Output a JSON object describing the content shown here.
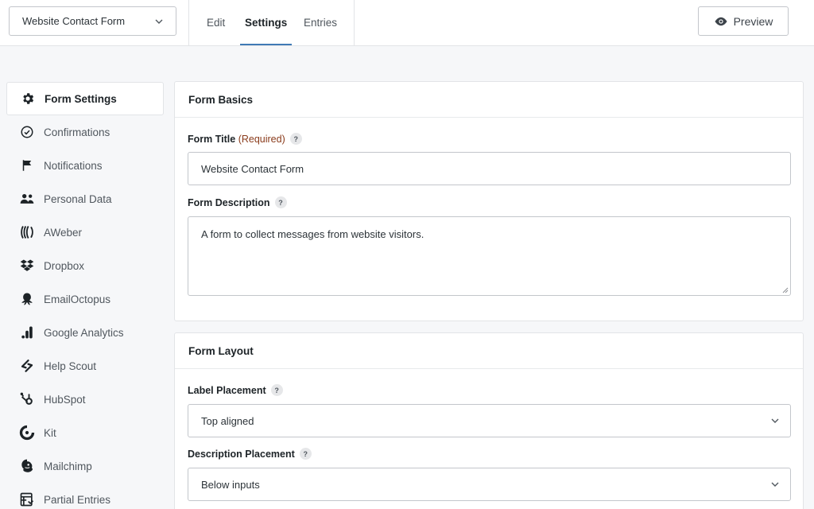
{
  "header": {
    "form_selector": "Website Contact Form",
    "tabs": [
      "Edit",
      "Settings",
      "Entries"
    ],
    "active_tab": "Settings",
    "preview_label": "Preview"
  },
  "sidebar": {
    "items": [
      {
        "label": "Form Settings",
        "icon": "gear-icon"
      },
      {
        "label": "Confirmations",
        "icon": "check-circle-icon"
      },
      {
        "label": "Notifications",
        "icon": "flag-icon"
      },
      {
        "label": "Personal Data",
        "icon": "users-icon"
      },
      {
        "label": "AWeber",
        "icon": "aweber-icon"
      },
      {
        "label": "Dropbox",
        "icon": "dropbox-icon"
      },
      {
        "label": "EmailOctopus",
        "icon": "octopus-icon"
      },
      {
        "label": "Google Analytics",
        "icon": "analytics-icon"
      },
      {
        "label": "Help Scout",
        "icon": "helpscout-icon"
      },
      {
        "label": "HubSpot",
        "icon": "hubspot-icon"
      },
      {
        "label": "Kit",
        "icon": "kit-icon"
      },
      {
        "label": "Mailchimp",
        "icon": "mailchimp-icon"
      },
      {
        "label": "Partial Entries",
        "icon": "partial-entries-icon"
      }
    ]
  },
  "form_basics": {
    "title": "Form Basics",
    "form_title_label": "Form Title",
    "required_text": "(Required)",
    "form_title_value": "Website Contact Form",
    "form_description_label": "Form Description",
    "form_description_value": "A form to collect messages from website visitors."
  },
  "form_layout": {
    "title": "Form Layout",
    "label_placement_label": "Label Placement",
    "label_placement_value": "Top aligned",
    "description_placement_label": "Description Placement",
    "description_placement_value": "Below inputs"
  },
  "help_glyph": "?"
}
